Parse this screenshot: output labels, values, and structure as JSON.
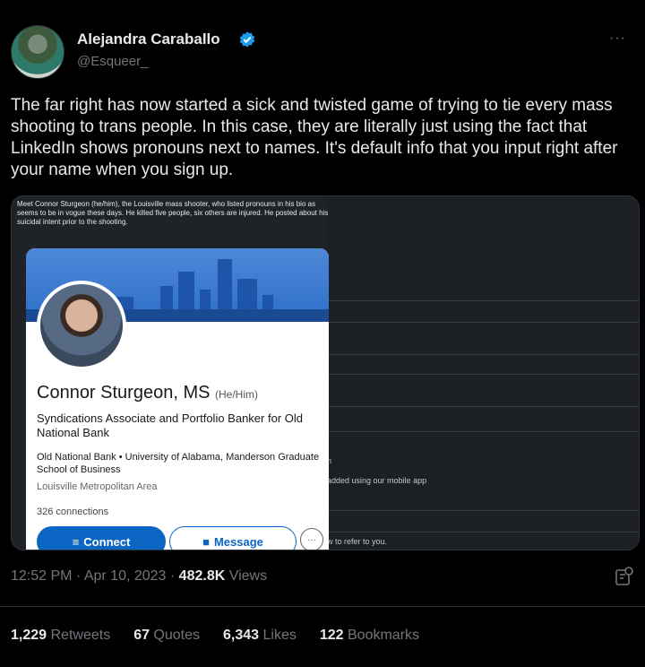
{
  "author": {
    "name": "Alejandra Caraballo",
    "handle": "@Esqueer_",
    "more": "···"
  },
  "tweet": {
    "text": "The far right has now started a sick and twisted game of trying to tie every mass shooting to trans people. In this case, they are literally just using the fact that LinkedIn shows pronouns next to names. It's default info that you input right after your name when you sign up."
  },
  "media": {
    "caption": "Meet Connor Sturgeon (he/him), the Louisville mass shooter, who listed pronouns in his bio as seems to be in vogue these days. He killed five people, six others are injured. He posted about his suicidal intent prior to the shooting.",
    "right_text_1": "n",
    "right_text_2": "added using our mobile app",
    "right_text_3": "w to refer to you.",
    "profile": {
      "name": "Connor Sturgeon, MS",
      "pronouns": "(He/Him)",
      "headline": "Syndications Associate and Portfolio Banker for Old National Bank",
      "education": "Old National Bank • University of Alabama, Manderson Graduate School of Business",
      "location": "Louisville Metropolitan Area",
      "connections": "326 connections",
      "connect_label": "Connect",
      "message_label": "Message",
      "more_label": "···"
    }
  },
  "meta": {
    "time": "12:52 PM · Apr 10, 2023 · ",
    "views_count": "482.8K",
    "views_label": " Views"
  },
  "stats": {
    "retweets_count": "1,229",
    "retweets_label": " Retweets",
    "quotes_count": "67",
    "quotes_label": " Quotes",
    "likes_count": "6,343",
    "likes_label": " Likes",
    "bookmarks_count": "122",
    "bookmarks_label": " Bookmarks"
  },
  "colors": {
    "background": "#000000",
    "text_primary": "#e7e9ea",
    "text_secondary": "#71767b",
    "verified": "#1d9bf0",
    "linkedin_blue": "#0a66c2"
  }
}
